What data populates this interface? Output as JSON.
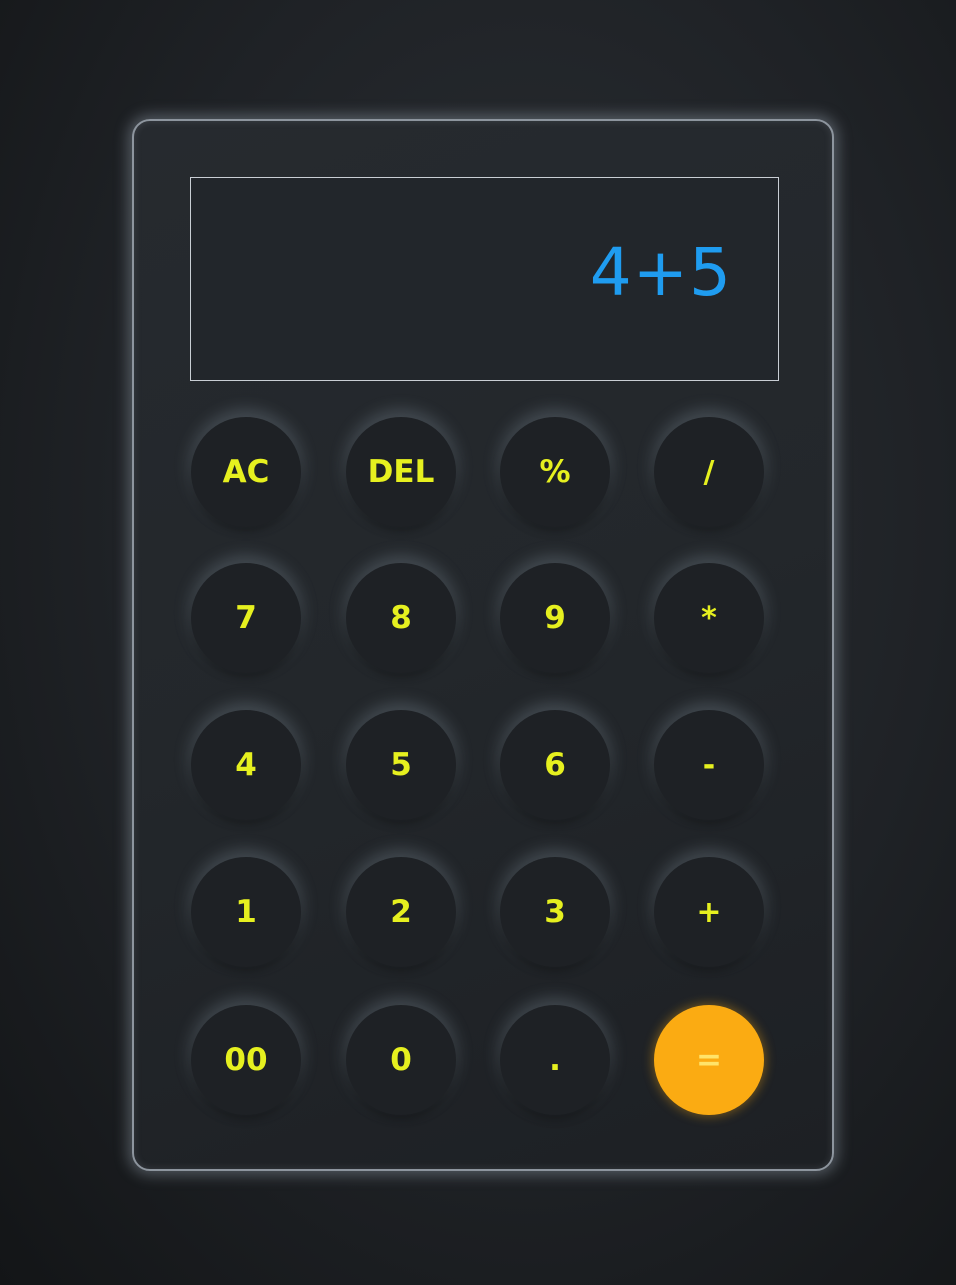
{
  "display": {
    "value": "4+5",
    "color": "#1f9cf0"
  },
  "colors": {
    "key_text": "#e6f01f",
    "equals_bg": "#fbab12",
    "frame_border": "#8d959e"
  },
  "keys": [
    [
      "AC",
      "DEL",
      "%",
      "/"
    ],
    [
      "7",
      "8",
      "9",
      "*"
    ],
    [
      "4",
      "5",
      "6",
      "-"
    ],
    [
      "1",
      "2",
      "3",
      "+"
    ],
    [
      "00",
      "0",
      ".",
      "="
    ]
  ]
}
